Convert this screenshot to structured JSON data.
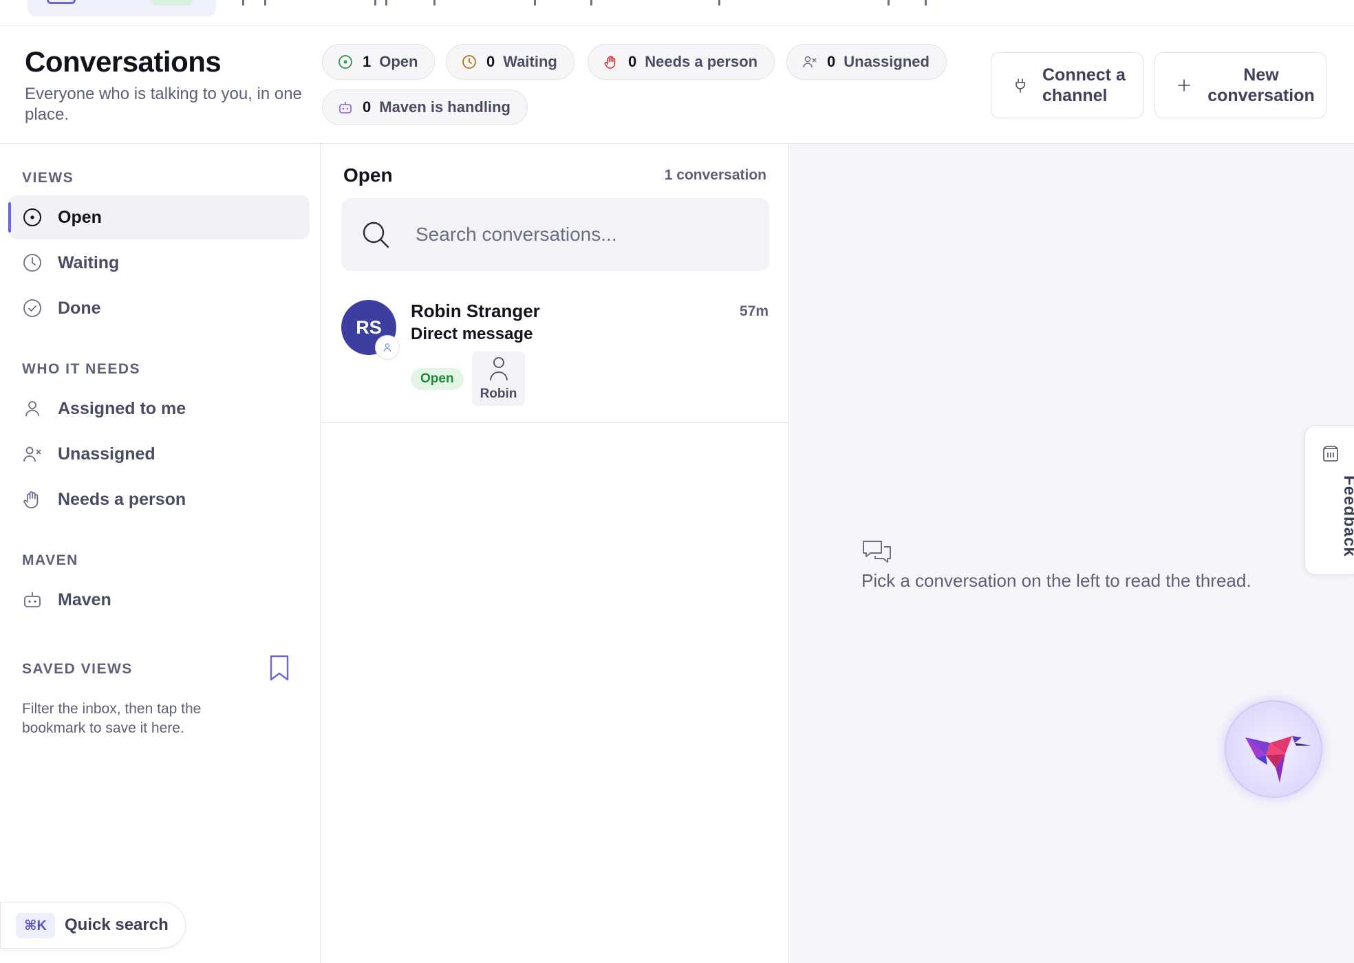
{
  "header": {
    "title": "Conversations",
    "subtitle": "Everyone who is talking to you, in one place."
  },
  "chips": [
    {
      "icon": "open-circle-icon",
      "count": "1",
      "label": "Open"
    },
    {
      "icon": "clock-icon",
      "count": "0",
      "label": "Waiting"
    },
    {
      "icon": "hand-icon",
      "count": "0",
      "label": "Needs a person"
    },
    {
      "icon": "user-x-icon",
      "count": "0",
      "label": "Unassigned"
    },
    {
      "icon": "bot-icon",
      "count": "0",
      "label": "Maven is handling"
    }
  ],
  "actions": {
    "connect_label": "Connect a channel",
    "new_label": "New conversation"
  },
  "sidebar": {
    "views_title": "VIEWS",
    "views": [
      {
        "label": "Open",
        "icon": "open-circle-icon",
        "active": true
      },
      {
        "label": "Waiting",
        "icon": "clock-icon"
      },
      {
        "label": "Done",
        "icon": "check-circle-icon"
      }
    ],
    "who_title": "WHO IT NEEDS",
    "who": [
      {
        "label": "Assigned to me",
        "icon": "user-icon"
      },
      {
        "label": "Unassigned",
        "icon": "user-x-icon"
      },
      {
        "label": "Needs a person",
        "icon": "hand-icon"
      }
    ],
    "maven_title": "MAVEN",
    "maven": [
      {
        "label": "Maven",
        "icon": "bot-icon"
      }
    ],
    "saved_title": "SAVED VIEWS",
    "saved_hint": "Filter the inbox, then tap the bookmark to save it here.",
    "quick_search_kbd": "⌘K",
    "quick_search_label": "Quick search"
  },
  "list": {
    "title": "Open",
    "count": "1 conversation",
    "search_placeholder": "Search conversations...",
    "conversations": [
      {
        "initials": "RS",
        "name": "Robin Stranger",
        "time": "57m",
        "subject": "Direct message",
        "status": "Open",
        "assignee": "Robin"
      }
    ]
  },
  "detail": {
    "empty_text": "Pick a conversation on the left to read the thread."
  },
  "feedback": {
    "label": "Feedback"
  },
  "colors": {
    "accent": "#6a64dc",
    "avatar": "#3c3ea0",
    "status_open_bg": "#e3f6e6",
    "status_open_fg": "#1f8a3a"
  }
}
